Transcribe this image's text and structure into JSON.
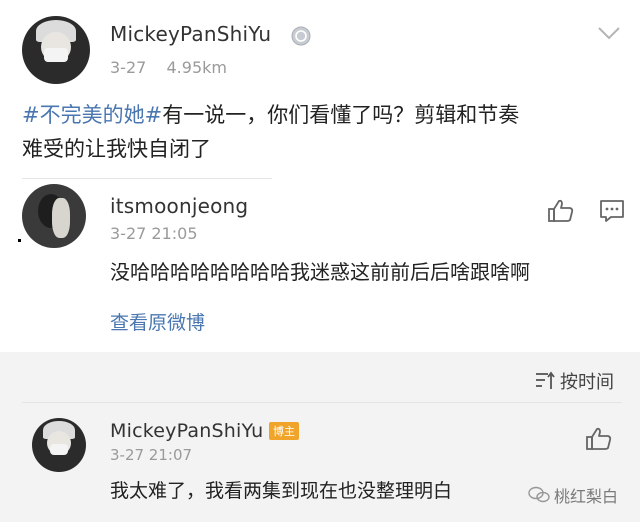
{
  "post": {
    "author": "MickeyPanShiYu",
    "date": "3-27",
    "distance": "4.95km",
    "topic": "#不完美的她#",
    "text_line1": "有一说一，你们看懂了吗？剪辑和节奏",
    "text_line2": "难受的让我快自闭了"
  },
  "quoted_comment": {
    "author": "itsmoonjeong",
    "time": "3-27 21:05",
    "text": "没哈哈哈哈哈哈哈哈我迷惑这前前后后啥跟啥啊",
    "view_original": "查看原微博"
  },
  "sort": {
    "label": "按时间"
  },
  "reply": {
    "author": "MickeyPanShiYu",
    "badge": "博主",
    "time": "3-27 21:07",
    "text": "我太难了，我看两集到现在也没整理明白"
  },
  "watermark": {
    "text": "桃红梨白"
  },
  "icons": {
    "chevron": "chevron-down-icon",
    "like": "thumbs-up-icon",
    "comment": "comment-icon",
    "sort": "sort-icon",
    "verified": "verified-badge-icon",
    "wechat": "wechat-icon"
  },
  "colors": {
    "link": "#4a77b0",
    "badge": "#f0a52a",
    "band": "#f3f3f3"
  }
}
